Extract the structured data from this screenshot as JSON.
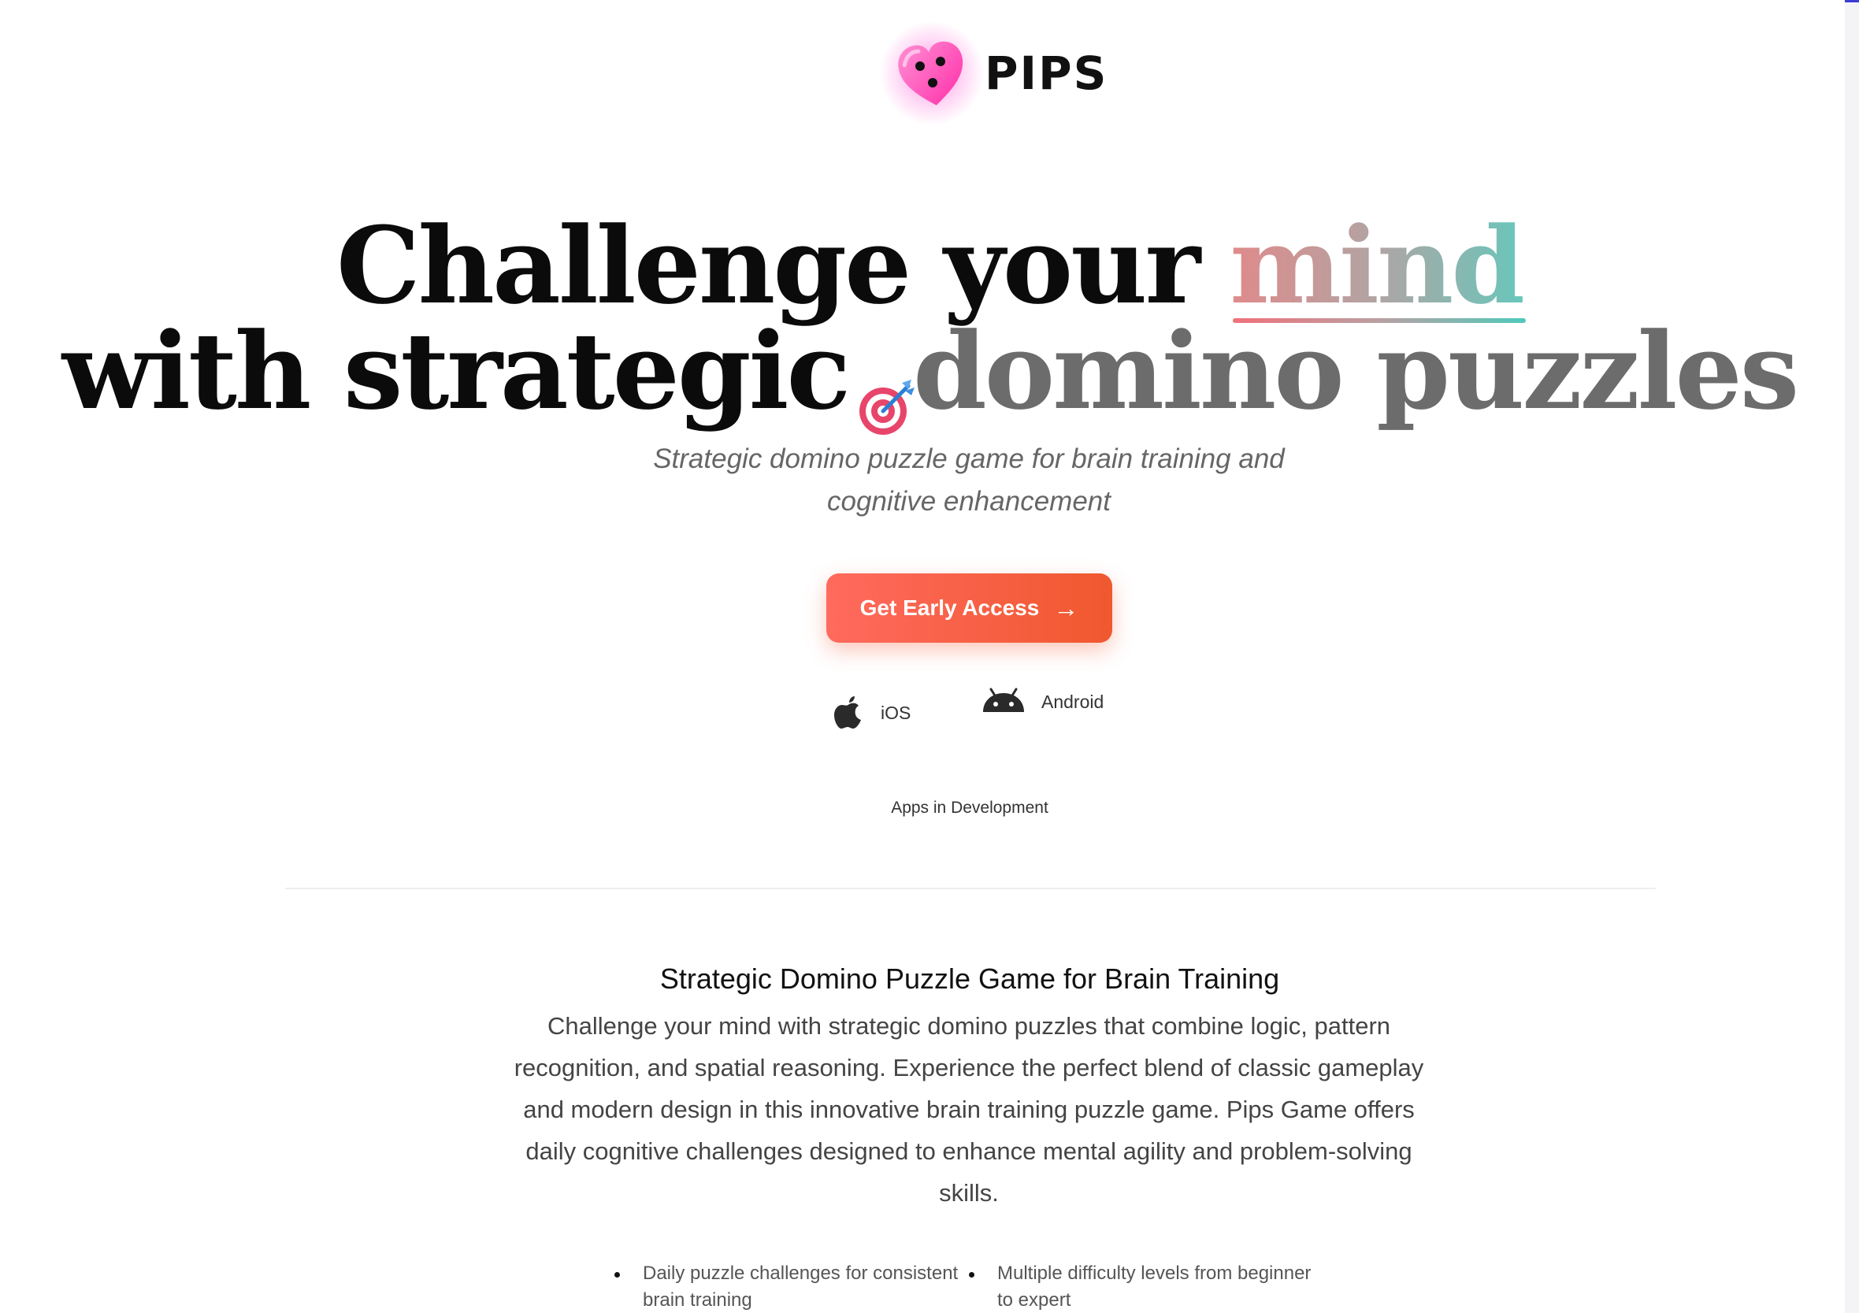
{
  "brand": {
    "name": "PIPS",
    "colors": {
      "logo": "#ff4fb8",
      "mind_gradient_start": "#e08a8a",
      "mind_gradient_end": "#69c6bb",
      "cta": "#f4623f"
    }
  },
  "hero": {
    "line1_text": "Challenge your",
    "line1_highlight": "mind",
    "line2_text": "with strategic",
    "line2_icon": "target-icon",
    "line2_highlight": "domino puzzles",
    "subtitle": "Strategic domino puzzle game for brain training and cognitive enhancement",
    "cta_label": "Get Early Access",
    "cta_icon": "arrow-right-icon"
  },
  "platforms": [
    {
      "label": "iOS",
      "icon": "apple-icon"
    },
    {
      "label": "Android",
      "icon": "android-icon"
    }
  ],
  "dev_note": "Apps in Development",
  "about": {
    "heading": "Strategic Domino Puzzle Game for Brain Training",
    "body": "Challenge your mind with strategic domino puzzles that combine logic, pattern recognition, and spatial reasoning. Experience the perfect blend of classic gameplay and modern design in this innovative brain training puzzle game. Pips Game offers daily cognitive challenges designed to enhance mental agility and problem-solving skills."
  },
  "features": [
    "Daily puzzle challenges for consistent brain training",
    "Multiple difficulty levels from beginner to expert"
  ]
}
